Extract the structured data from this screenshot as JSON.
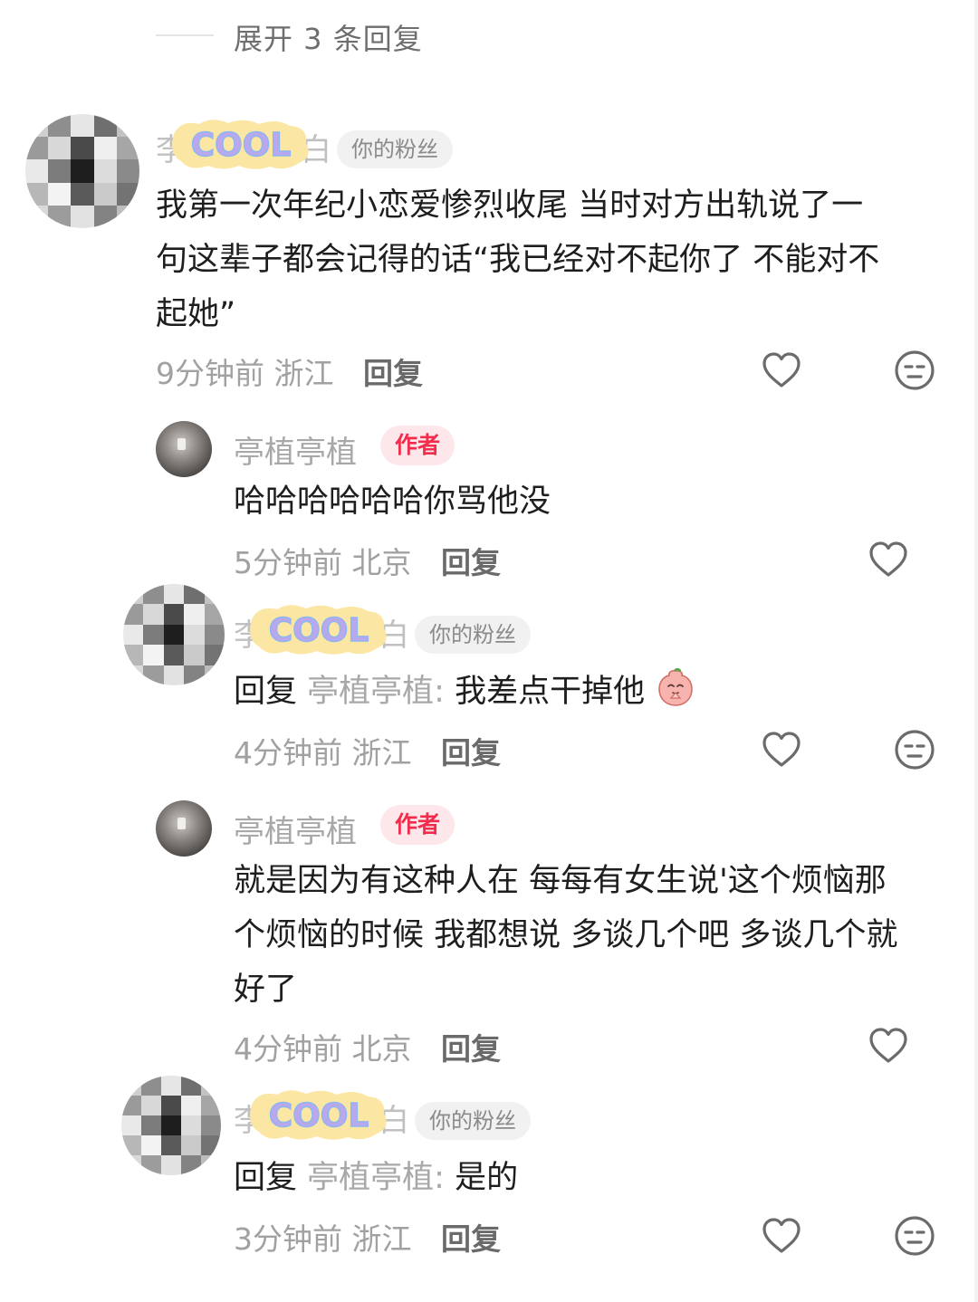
{
  "expand": {
    "label": "展开 3 条回复"
  },
  "comments": [
    {
      "name_left": "李",
      "name_right": "白",
      "badge": "COOL",
      "tag": "你的粉丝",
      "text": "我第一次年纪小恋爱惨烈收尾 当时对方出轨说了一句这辈子都会记得的话“我已经对不起你了 不能对不起她”",
      "lines": [
        "我第一次年纪小恋爱惨烈收尾 当时对方出轨说了一",
        "句这辈子都会记得的话“我已经对不起你了 不能对不",
        "起她”"
      ],
      "time": "9分钟前",
      "location": "浙江",
      "reply_label": "回复"
    },
    {
      "name": "亭植亭植",
      "tag": "作者",
      "text": "哈哈哈哈哈哈你骂他没",
      "time": "5分钟前",
      "location": "北京",
      "reply_label": "回复"
    },
    {
      "name_left": "李",
      "name_right": "白",
      "badge": "COOL",
      "tag": "你的粉丝",
      "reply_prefix": "回复",
      "reply_to": "亭植亭植:",
      "text": "我差点干掉他",
      "time": "4分钟前",
      "location": "浙江",
      "reply_label": "回复"
    },
    {
      "name": "亭植亭植",
      "tag": "作者",
      "lines": [
        "就是因为有这种人在 每每有女生说'这个烦恼那",
        "个烦恼的时候 我都想说 多谈几个吧 多谈几个就",
        "好了"
      ],
      "time": "4分钟前",
      "location": "北京",
      "reply_label": "回复"
    },
    {
      "name_left": "李",
      "name_right": "白",
      "badge": "COOL",
      "tag": "你的粉丝",
      "reply_prefix": "回复",
      "reply_to": "亭植亭植:",
      "text": "是的",
      "time": "3分钟前",
      "location": "浙江",
      "reply_label": "回复"
    }
  ],
  "icons": {
    "like": "heart-outline-icon",
    "dislike": "neutral-face-icon",
    "emoji": "praying-peach-emoji"
  },
  "colors": {
    "author_tag_bg": "#fde7ea",
    "author_tag_text": "#f12c4d",
    "fan_tag_bg": "#f1f1f1"
  }
}
